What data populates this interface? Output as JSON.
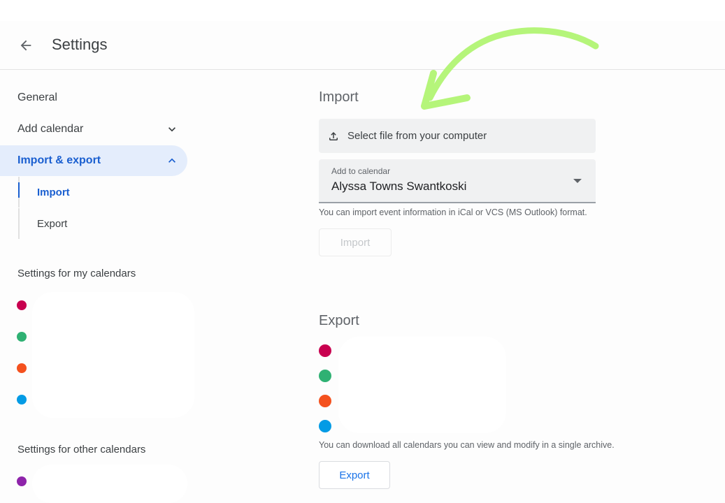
{
  "header": {
    "back_icon": "arrow-left-icon",
    "title": "Settings"
  },
  "sidebar": {
    "items": [
      {
        "label": "General",
        "icon": null
      },
      {
        "label": "Add calendar",
        "icon": "chevron-down-icon"
      },
      {
        "label": "Import & export",
        "icon": "chevron-up-icon",
        "active": true
      }
    ],
    "sub_items": [
      {
        "label": "Import",
        "active": true
      },
      {
        "label": "Export",
        "active": false
      }
    ],
    "my_calendars_label": "Settings for my calendars",
    "my_calendars": [
      {
        "color": "#c8004f",
        "name": ""
      },
      {
        "color": "#2fb173",
        "name": ""
      },
      {
        "color": "#f4511e",
        "name": ""
      },
      {
        "color": "#039be5",
        "name": ""
      }
    ],
    "other_calendars_label": "Settings for other calendars",
    "other_calendars": [
      {
        "color": "#8e24aa",
        "name": ""
      }
    ]
  },
  "import": {
    "heading": "Import",
    "file_button_label": "Select file from your computer",
    "file_button_icon": "upload-icon",
    "calendar_select_label": "Add to calendar",
    "calendar_select_value": "Alyssa Towns Swantkoski",
    "hint": "You can import event information in iCal or VCS (MS Outlook) format.",
    "import_button_label": "Import"
  },
  "export": {
    "heading": "Export",
    "calendars": [
      {
        "color": "#c8004f",
        "name": ""
      },
      {
        "color": "#2fb173",
        "name": ""
      },
      {
        "color": "#f4511e",
        "name": ""
      },
      {
        "color": "#039be5",
        "name": ""
      }
    ],
    "hint": "You can download all calendars you can view and modify in a single archive.",
    "export_button_label": "Export"
  },
  "annotation": {
    "type": "curved-arrow",
    "color": "#b5f57a"
  },
  "colors": {
    "accent": "#1a73e8",
    "active_bg": "#e4edfc"
  }
}
